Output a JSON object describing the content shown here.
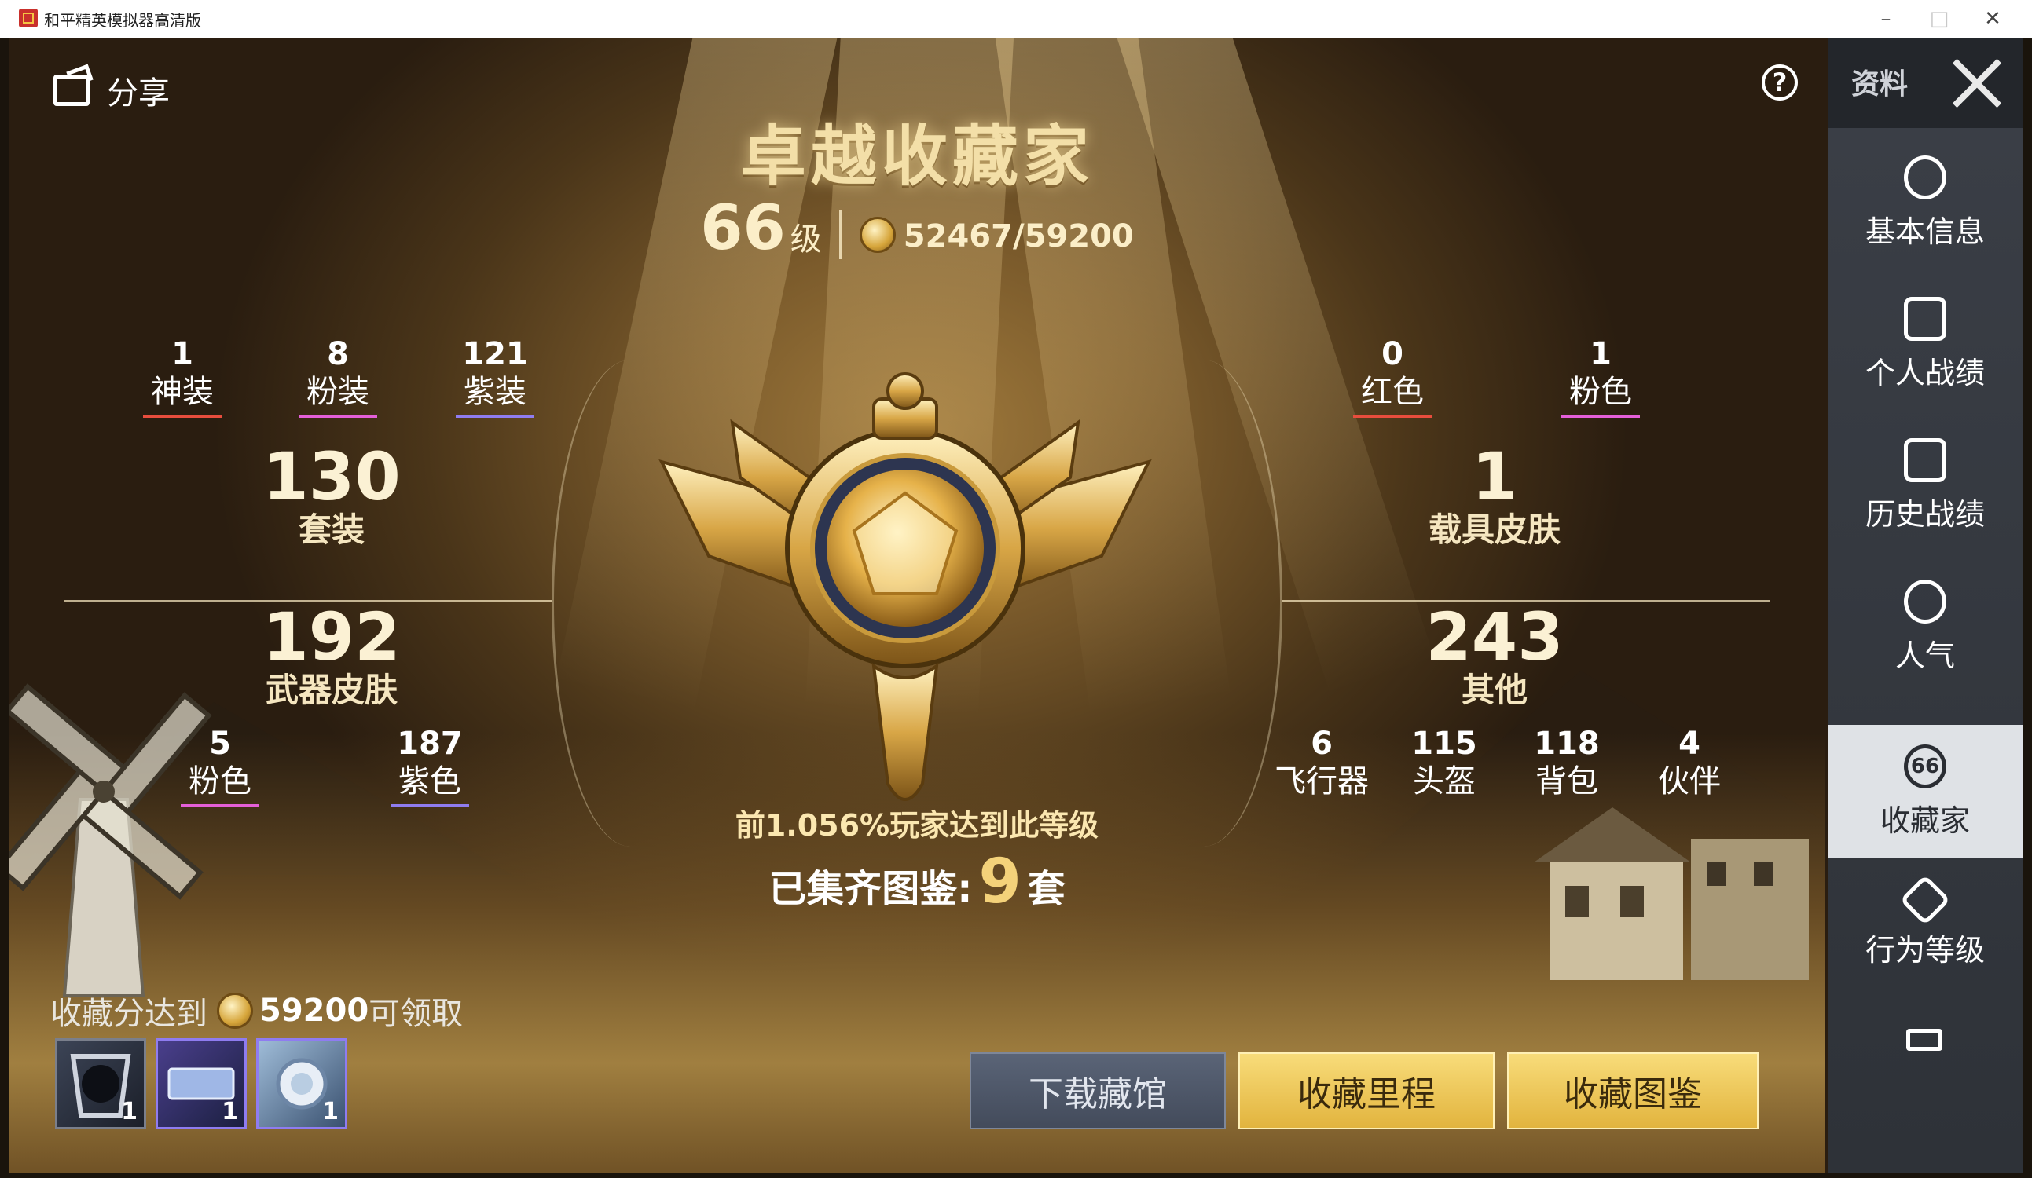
{
  "window": {
    "title": "和平精英模拟器高清版",
    "minimize": "–",
    "maximize": "□",
    "close": "✕"
  },
  "header": {
    "share_label": "分享",
    "help_icon": "?"
  },
  "collector": {
    "title": "卓越收藏家",
    "level": "66",
    "level_unit": "级",
    "score": "52467/59200"
  },
  "left_top_stats": [
    {
      "count": "1",
      "label": "神装",
      "color": "#e84d3d"
    },
    {
      "count": "8",
      "label": "粉装",
      "color": "#e45fd8"
    },
    {
      "count": "121",
      "label": "紫装",
      "color": "#8f7cf0"
    }
  ],
  "right_top_stats": [
    {
      "count": "0",
      "label": "红色",
      "color": "#e84d3d"
    },
    {
      "count": "1",
      "label": "粉色",
      "color": "#e45fd8"
    }
  ],
  "suits": {
    "count": "130",
    "label": "套装"
  },
  "vehicle": {
    "count": "1",
    "label": "载具皮肤"
  },
  "weapon": {
    "count": "192",
    "label": "武器皮肤"
  },
  "other": {
    "count": "243",
    "label": "其他"
  },
  "weapon_stats": [
    {
      "count": "5",
      "label": "粉色",
      "color": "#e45fd8"
    },
    {
      "count": "187",
      "label": "紫色",
      "color": "#8f7cf0"
    }
  ],
  "other_stats": [
    {
      "count": "6",
      "label": "飞行器"
    },
    {
      "count": "115",
      "label": "头盔"
    },
    {
      "count": "118",
      "label": "背包"
    },
    {
      "count": "4",
      "label": "伙伴"
    }
  ],
  "rank_text": "前1.056%玩家达到此等级",
  "sets": {
    "label": "已集齐图鉴:",
    "count": "9",
    "unit": "套"
  },
  "reward": {
    "prefix": "收藏分达到",
    "score": "59200",
    "suffix": "可领取",
    "items": [
      {
        "count": "1"
      },
      {
        "count": "1"
      },
      {
        "count": "1"
      }
    ]
  },
  "buttons": {
    "download": "下载藏馆",
    "milestone": "收藏里程",
    "atlas": "收藏图鉴"
  },
  "sidebar": {
    "top_label": "资料",
    "items": [
      {
        "label": "基本信息"
      },
      {
        "label": "个人战绩"
      },
      {
        "label": "历史战绩"
      },
      {
        "label": "人气"
      },
      {
        "label": "收藏家",
        "badge": "66"
      },
      {
        "label": "行为等级"
      }
    ]
  }
}
